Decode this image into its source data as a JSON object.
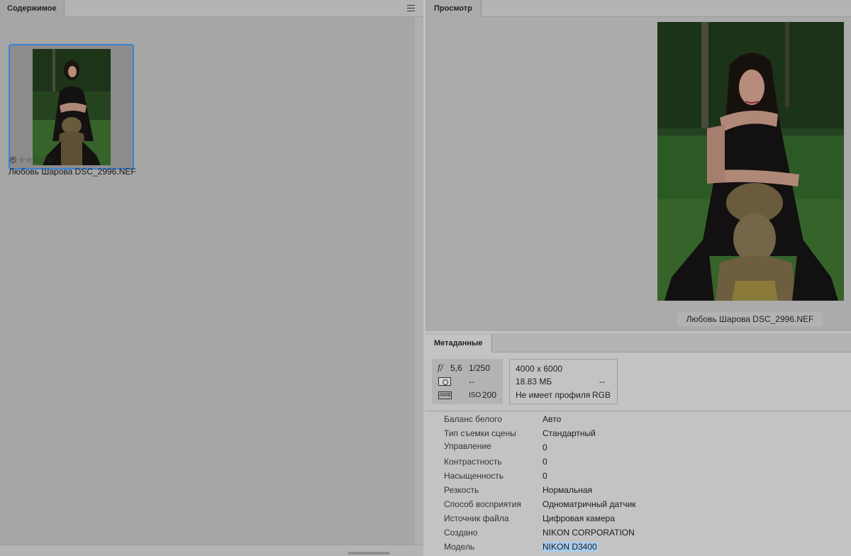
{
  "content_panel": {
    "tab_label": "Содержимое",
    "menu_icon": "hamburger-menu-icon",
    "thumbnail": {
      "caption": "Любовь Шарова DSC_2996.NEF",
      "rating_stars": "☆☆☆☆☆",
      "reject_icon": "reject-circle-icon",
      "selection_color": "#3b82d9"
    }
  },
  "preview_panel": {
    "tab_label": "Просмотр",
    "caption": "Любовь Шарова DSC_2996.NEF"
  },
  "metadata_panel": {
    "tab_label": "Метаданные",
    "exif": {
      "aperture_icon": "f/",
      "aperture": "5,6",
      "shutter": "1/250",
      "metering_icon": "metering-icon",
      "metering_value": "--",
      "wb_icon": "AWB",
      "iso_label": "ISO",
      "iso": "200"
    },
    "file_info": {
      "dimensions": "4000 x 6000",
      "size": "18.83 МБ",
      "resolution": "--",
      "profile": "Не имеет профиля",
      "color_mode": "RGB"
    },
    "rows": [
      {
        "key": "Баланс белого",
        "value": "Авто"
      },
      {
        "key": "Тип съемки сцены",
        "value": "Стандартный"
      },
      {
        "key": "Управление",
        "value": "0"
      },
      {
        "key": "Контрастность",
        "value": "0"
      },
      {
        "key": "Насыщенность",
        "value": "0"
      },
      {
        "key": "Резкость",
        "value": "Нормальная"
      },
      {
        "key": "Способ восприятия",
        "value": "Одноматричный датчик"
      },
      {
        "key": "Источник файла",
        "value": "Цифровая камера"
      },
      {
        "key": "Создано",
        "value": "NIKON CORPORATION"
      },
      {
        "key": "Модель",
        "value": "NIKON D3400"
      }
    ]
  }
}
